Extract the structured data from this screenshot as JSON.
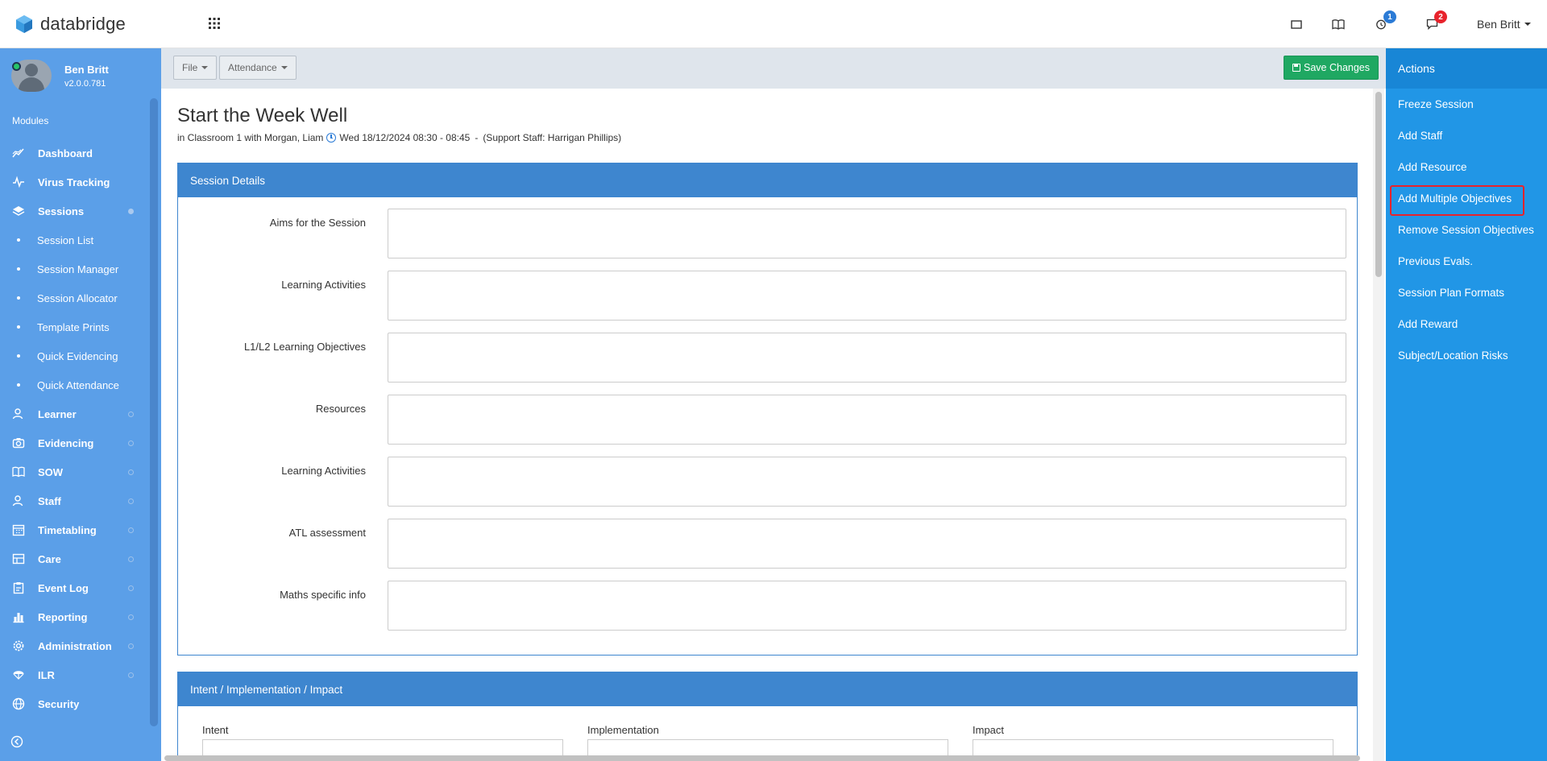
{
  "app": {
    "name": "databridge",
    "user_menu_label": "Ben Britt"
  },
  "topbar": {
    "icons": [
      {
        "name": "window-icon"
      },
      {
        "name": "book-icon"
      },
      {
        "name": "alarm-clock-icon",
        "badge": "1",
        "badge_color": "#2b7bd6"
      },
      {
        "name": "chat-icon",
        "badge": "2",
        "badge_color": "#e8232c"
      }
    ]
  },
  "sidebar": {
    "user_name": "Ben Britt",
    "version": "v2.0.0.781",
    "modules_label": "Modules",
    "items": [
      {
        "label": "Dashboard",
        "icon": "chart-line-icon"
      },
      {
        "label": "Virus Tracking",
        "icon": "pulse-icon"
      },
      {
        "label": "Sessions",
        "icon": "layers-icon",
        "expanded": true,
        "children": [
          "Session List",
          "Session Manager",
          "Session Allocator",
          "Template Prints",
          "Quick Evidencing",
          "Quick Attendance"
        ]
      },
      {
        "label": "Learner",
        "icon": "learner-icon"
      },
      {
        "label": "Evidencing",
        "icon": "camera-icon"
      },
      {
        "label": "SOW",
        "icon": "open-book-icon"
      },
      {
        "label": "Staff",
        "icon": "staff-icon"
      },
      {
        "label": "Timetabling",
        "icon": "calendar-icon"
      },
      {
        "label": "Care",
        "icon": "care-icon"
      },
      {
        "label": "Event Log",
        "icon": "clipboard-icon"
      },
      {
        "label": "Reporting",
        "icon": "bar-chart-icon"
      },
      {
        "label": "Administration",
        "icon": "gear-icon"
      },
      {
        "label": "ILR",
        "icon": "parachute-icon"
      },
      {
        "label": "Security",
        "icon": "globe-icon"
      }
    ]
  },
  "toolbar": {
    "file_label": "File",
    "attendance_label": "Attendance",
    "save_label": "Save Changes"
  },
  "session": {
    "title": "Start the Week Well",
    "subtitle_prefix": "in Classroom 1 with Morgan, Liam",
    "subtitle_time": "Wed 18/12/2024 08:30 - 08:45",
    "subtitle_sep": "-",
    "subtitle_support": "(Support Staff: Harrigan Phillips)"
  },
  "details_panel": {
    "title": "Session Details",
    "fields": [
      {
        "label": "Aims for the Session",
        "value": ""
      },
      {
        "label": "Learning Activities",
        "value": ""
      },
      {
        "label": "L1/L2 Learning Objectives",
        "value": ""
      },
      {
        "label": "Resources",
        "value": ""
      },
      {
        "label": "Learning Activities",
        "value": ""
      },
      {
        "label": "ATL assessment",
        "value": ""
      },
      {
        "label": "Maths specific info",
        "value": ""
      }
    ]
  },
  "iii_panel": {
    "title": "Intent / Implementation / Impact",
    "columns": [
      "Intent",
      "Implementation",
      "Impact"
    ]
  },
  "actions": {
    "title": "Actions",
    "items": [
      "Freeze Session",
      "Add Staff",
      "Add Resource",
      "Add Multiple Objectives",
      "Remove Session Objectives",
      "Previous Evals.",
      "Session Plan Formats",
      "Add Reward",
      "Subject/Location Risks"
    ],
    "highlighted_index": 3
  },
  "colors": {
    "sidebar": "#5b9fe8",
    "actions_panel": "#2196e6",
    "panel_header": "#3e86cf",
    "save_button": "#1fa862",
    "highlight": "#e8232c"
  }
}
